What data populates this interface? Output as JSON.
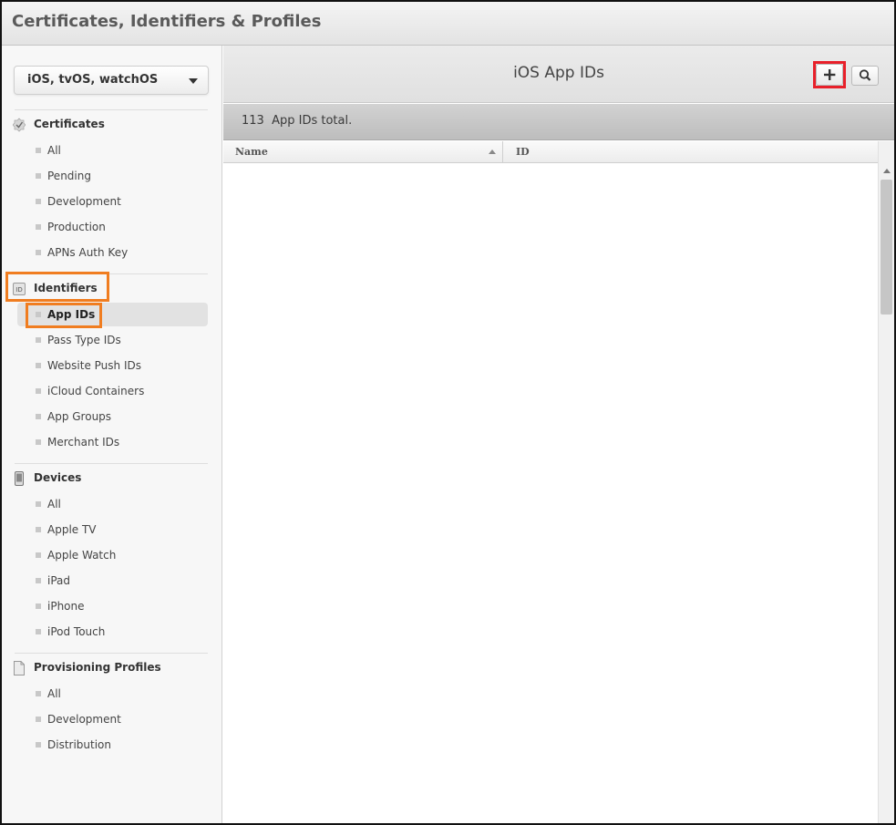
{
  "header": {
    "title": "Certificates, Identifiers & Profiles"
  },
  "sidebar": {
    "platform": {
      "label": "iOS, tvOS, watchOS"
    },
    "sections": {
      "certificates": {
        "title": "Certificates",
        "icon": "certificate-check-icon",
        "items": [
          "All",
          "Pending",
          "Development",
          "Production",
          "APNs Auth Key"
        ]
      },
      "identifiers": {
        "title": "Identifiers",
        "icon": "id-badge-icon",
        "items": [
          "App IDs",
          "Pass Type IDs",
          "Website Push IDs",
          "iCloud Containers",
          "App Groups",
          "Merchant IDs"
        ],
        "active_item": "App IDs"
      },
      "devices": {
        "title": "Devices",
        "icon": "device-phone-icon",
        "items": [
          "All",
          "Apple TV",
          "Apple Watch",
          "iPad",
          "iPhone",
          "iPod Touch"
        ]
      },
      "profiles": {
        "title": "Provisioning Profiles",
        "icon": "document-icon",
        "items": [
          "All",
          "Development",
          "Distribution"
        ]
      }
    }
  },
  "main": {
    "title": "iOS App IDs",
    "add_icon": "plus-icon",
    "search_icon": "search-icon",
    "count": "113",
    "count_label": "App IDs total.",
    "columns": [
      "Name",
      "ID"
    ],
    "sort_indicator": "ascending"
  },
  "colors": {
    "highlight_orange": "#f07d20",
    "highlight_red": "#e8202a",
    "active_item_bg": "#e2e2e2"
  }
}
